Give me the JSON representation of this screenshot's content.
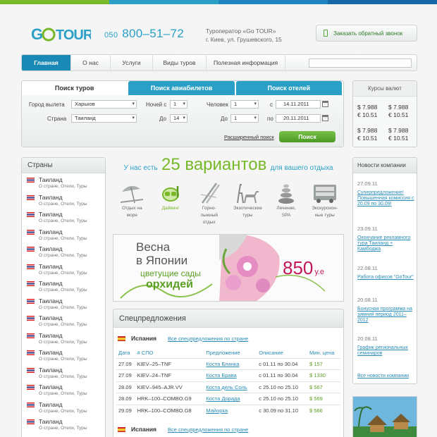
{
  "colors": {
    "blue": "#2aa0c6",
    "green": "#78b829",
    "topbar": [
      "#78b829",
      "#2aa0c6",
      "#1f86c1",
      "#1668a6"
    ]
  },
  "header": {
    "logo_text": "GoTOUR",
    "phone_code": "050",
    "phone_number": "800–51–72",
    "agency_line1": "Туроператор «Go TOUR»",
    "agency_line2": "г. Киев, ул. Грушевского, 15",
    "callback_label": "Заказать обратный звонок"
  },
  "nav": {
    "items": [
      "Главная",
      "О нас",
      "Услуги",
      "Виды туров",
      "Полезная информация"
    ],
    "search_placeholder": ""
  },
  "search": {
    "tabs": [
      "Поиск туров",
      "Поиск авиабилетов",
      "Поиск отелей"
    ],
    "departure_label": "Город вылета",
    "departure_value": "Харьков",
    "country_label": "Страна",
    "country_value": "Таиланд",
    "nights_label": "Ночей с",
    "nights_from": "1",
    "to_label": "До",
    "nights_to": "14",
    "people_label": "Человек",
    "people_from": "1",
    "people_to": "1",
    "date_from_label": "с",
    "date_from": "14.11.2011",
    "date_to_label": "по",
    "date_to": "20.11.2011",
    "advanced_link": "Расширенный поиск",
    "find_button": "Поиск"
  },
  "rates": {
    "title": "Курсы валют",
    "rows": [
      {
        "left": "$ 7.988",
        "left2": "€ 10.51",
        "right": "$ 7.988",
        "right2": "€ 10.51"
      },
      {
        "left": "$ 7.988",
        "left2": "€ 10.51",
        "right": "$ 7.988",
        "right2": "€ 10.51"
      }
    ]
  },
  "countries": {
    "title": "Страны",
    "items": [
      {
        "name": "Таиланд",
        "sub": "О стране, Отели, Туры"
      },
      {
        "name": "Таиланд",
        "sub": "О стране, Отели, Туры"
      },
      {
        "name": "Таиланд",
        "sub": "О стране, Отели, Туры"
      },
      {
        "name": "Таиланд",
        "sub": "О стране, Отели, Туры"
      },
      {
        "name": "Таиланд",
        "sub": "О стране, Отели, Туры"
      },
      {
        "name": "Таиланд",
        "sub": "О стране, Отели, Туры"
      },
      {
        "name": "Таиланд",
        "sub": "О стране, Отели, Туры"
      },
      {
        "name": "Таиланд",
        "sub": "О стране, Отели, Туры"
      },
      {
        "name": "Таиланд",
        "sub": "О стране, Отели, Туры"
      },
      {
        "name": "Таиланд",
        "sub": "О стране, Отели, Туры"
      },
      {
        "name": "Таиланд",
        "sub": "О стране, Отели, Туры"
      },
      {
        "name": "Таиланд",
        "sub": "О стране, Отели, Туры"
      },
      {
        "name": "Таиланд",
        "sub": "О стране, Отели, Туры"
      },
      {
        "name": "Таиланд",
        "sub": "О стране, Отели, Туры"
      },
      {
        "name": "Таиланд",
        "sub": "О стране, Отели, Туры"
      },
      {
        "name": "Таиланд",
        "sub": "О стране, Отели, Туры"
      }
    ]
  },
  "headline": {
    "before": "У нас есть",
    "big": "25 вариантов",
    "after": "для вашего отдыха"
  },
  "categories": [
    {
      "line1": "Отдых на",
      "line2": "море",
      "line3": "",
      "icon": "beach-umbrella-icon"
    },
    {
      "line1": "Дайвинг",
      "line2": "",
      "line3": "",
      "icon": "diving-mask-icon"
    },
    {
      "line1": "Горно-",
      "line2": "лыжный",
      "line3": "отдых",
      "icon": "ski-icon"
    },
    {
      "line1": "Экзотические",
      "line2": "туры",
      "line3": "",
      "icon": "safari-animals-icon"
    },
    {
      "line1": "Лечение,",
      "line2": "SPA",
      "line3": "",
      "icon": "spa-stones-icon"
    },
    {
      "line1": "Экскурсион-",
      "line2": "ные туры",
      "line3": "",
      "icon": "bus-icon"
    }
  ],
  "banner": {
    "line1": "Весна",
    "line2": "в Японии",
    "line3": "цветущие сады",
    "line4": "орхидей",
    "price": "850",
    "currency": "у.е"
  },
  "specials": {
    "title": "Спецпредложения",
    "country1": "Испания",
    "country2": "Испания",
    "all_link": "Все спецпредложения по стране",
    "headers": [
      "Дата",
      "# СПО",
      "Предложение",
      "Описание",
      "Мин. цена"
    ],
    "rows": [
      [
        "27.09",
        "KIEV–25–TNF",
        "Коста Бланка",
        "с 01.11 по 30.04",
        "$ 157"
      ],
      [
        "27.09",
        "KIEV–24–TNF",
        "Коста Брава",
        "с 01.11 по 30.04",
        "$ 1330"
      ],
      [
        "28.09",
        "KIEV–945–AJR.VV",
        "Коста дель Соль",
        "с 25.10 по 25.10",
        "$ 567"
      ],
      [
        "28.09",
        "HRK–100–COMBO.G9",
        "Коста Дорада",
        "с 25.10 по 25.10",
        "$ 569"
      ],
      [
        "29.09",
        "HRK–100–COMBO.G8",
        "Майорка",
        "с 30.09 по 31.10",
        "$ 566"
      ]
    ]
  },
  "news": {
    "title": "Новости компании",
    "items": [
      {
        "date": "27.09.11",
        "text": "Суперпредложение! Повышенная комиссия с 20.09 по 30.09!"
      },
      {
        "date": "23.09.11",
        "text": "Окончание рекламного тура Таиланд + Камбоджа"
      },
      {
        "date": "22.08.11",
        "text": "Работа офисов \"GoTour\""
      },
      {
        "date": "20.08.11",
        "text": "Бонусная программа на зимний период 2011–2012"
      },
      {
        "date": "20.08.11",
        "text": "График региональных семинаров"
      }
    ],
    "all_link": "Все новости компании"
  }
}
